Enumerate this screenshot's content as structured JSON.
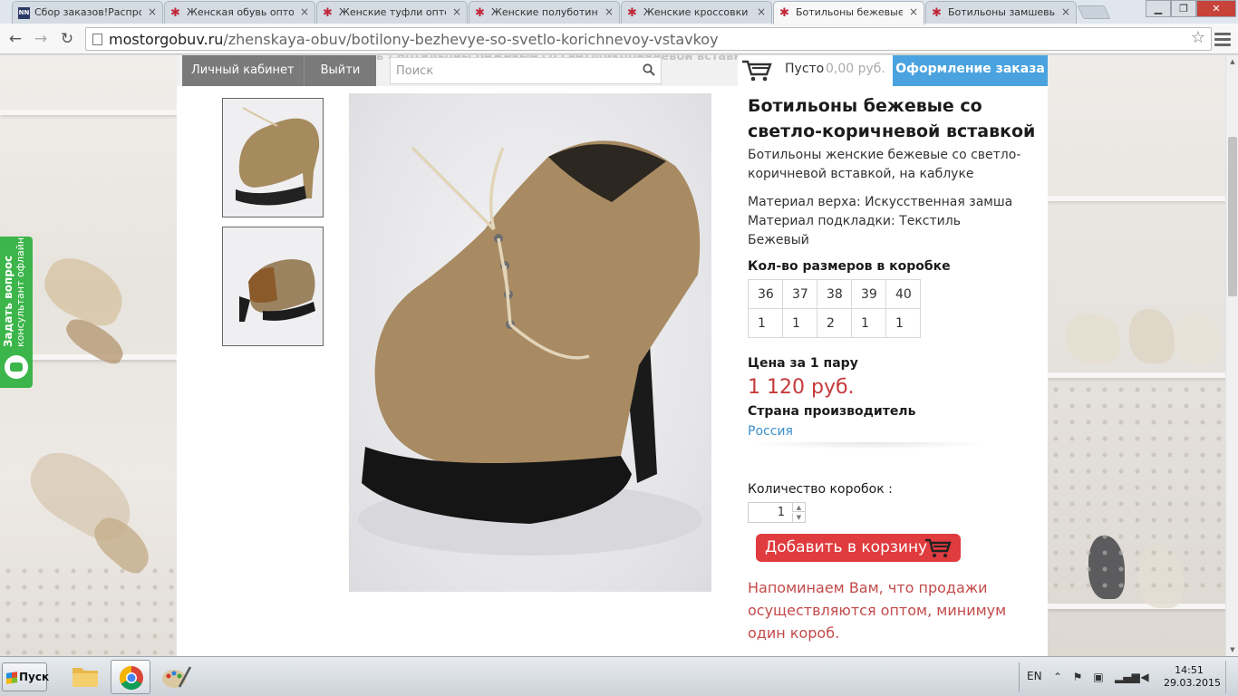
{
  "browser": {
    "tabs": [
      {
        "title": "Сбор заказов!Распрод",
        "icon": "nn-icon"
      },
      {
        "title": "Женская обувь оптом",
        "icon": "star-icon"
      },
      {
        "title": "Женские туфли оптом",
        "icon": "star-icon"
      },
      {
        "title": "Женские полуботинки",
        "icon": "star-icon"
      },
      {
        "title": "Женские кроссовки оп",
        "icon": "star-icon"
      },
      {
        "title": "Ботильоны бежевые с",
        "icon": "star-icon"
      },
      {
        "title": "Ботильоны замшевые",
        "icon": "star-icon"
      }
    ],
    "active_tab": 5,
    "url_host": "mostorgobuv.ru",
    "url_path": "/zhenskaya-obuv/botilony-bezhevye-so-svetlo-korichnevoy-vstavkoy",
    "window_controls": {
      "minimize": "▁",
      "maximize": "❐",
      "close": "✕"
    }
  },
  "site": {
    "breadcrumb_ghost": "Главная › Женская обувь › Ботильоны бежевые со светло-коричневой вставкой",
    "nav": {
      "account": "Личный кабинет",
      "logout": "Выйти"
    },
    "search_placeholder": "Поиск",
    "cart": {
      "status": "Пусто",
      "sum": "0,00 руб."
    },
    "checkout": "Оформление заказа"
  },
  "product": {
    "title": "Ботильоны бежевые со светло-коричневой вставкой",
    "description": "Ботильоны женские бежевые со светло-коричневой вставкой, на каблуке",
    "specs": [
      "Материал верха: Искусственная замша",
      "Материал подкладки: Текстиль",
      "Бежевый"
    ],
    "sizes_label": "Кол-во размеров в коробке",
    "sizes": [
      "36",
      "37",
      "38",
      "39",
      "40"
    ],
    "counts": [
      "1",
      "1",
      "2",
      "1",
      "1"
    ],
    "price_label": "Цена за 1 пару",
    "price": "1 120 руб.",
    "country_label": "Страна производитель",
    "country": "Россия",
    "qty_label": "Количество коробок :",
    "qty_value": "1",
    "add_to_cart": "Добавить в корзину",
    "notice": "Напоминаем Вам, что продажи осуществляются оптом, минимум один короб."
  },
  "consult": {
    "line1": "Задать вопрос",
    "line2": "консультант офлайн"
  },
  "taskbar": {
    "start": "Пуск",
    "lang": "EN",
    "time": "14:51",
    "date": "29.03.2015"
  },
  "colors": {
    "accent_blue": "#4aa3df",
    "cart_red": "#e03b3e",
    "price_red": "#c73a3a",
    "consult_green": "#3cb54a"
  }
}
